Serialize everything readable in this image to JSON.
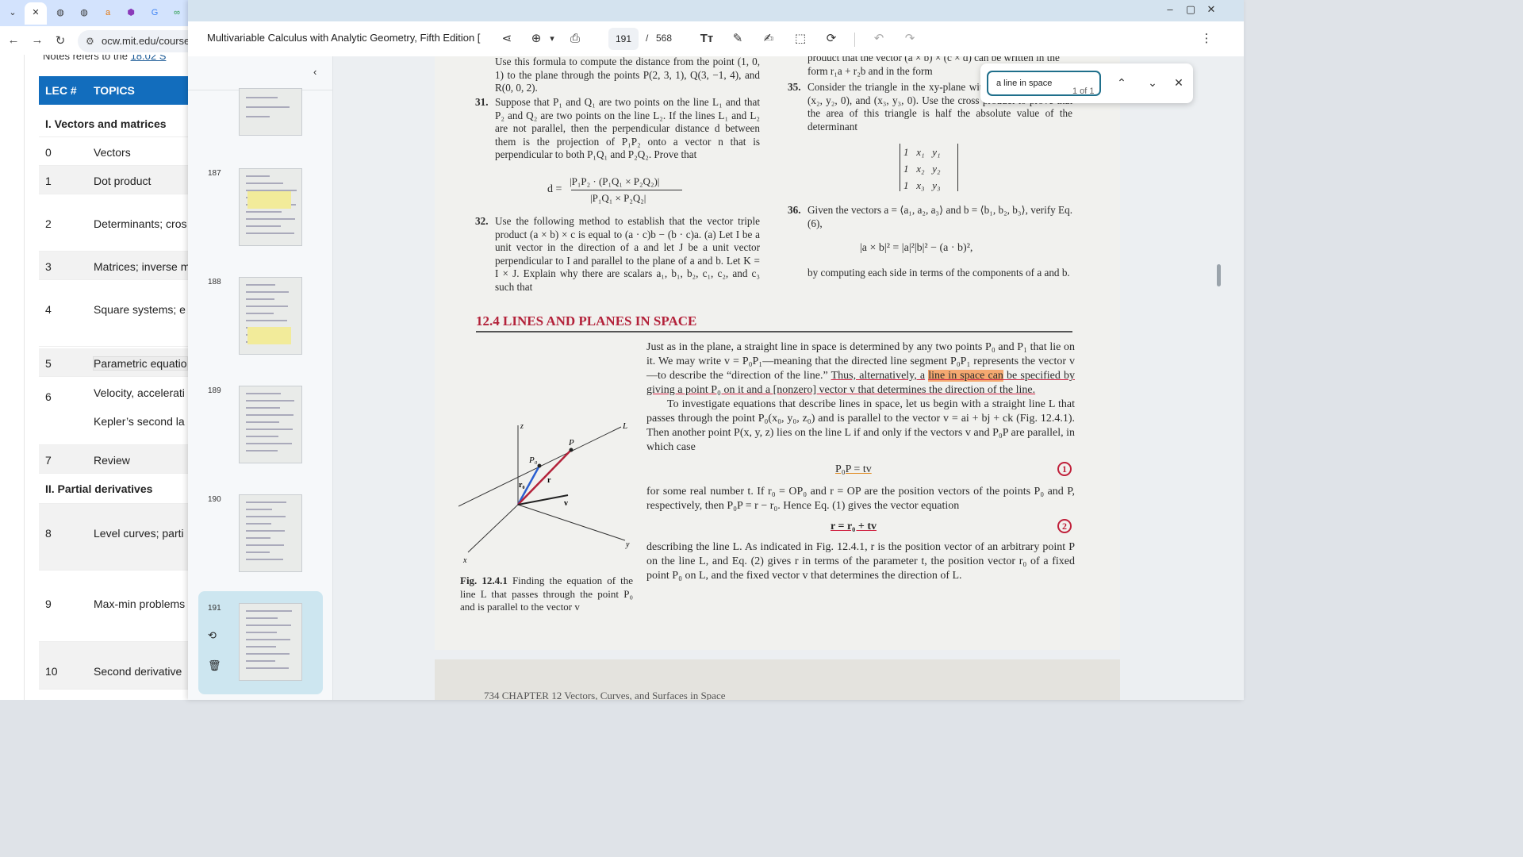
{
  "browser": {
    "url": "ocw.mit.edu/courses..."
  },
  "ocw": {
    "notes_prefix": "Notes refers to the",
    "notes_link": "18.02 S",
    "header": {
      "num": "LEC #",
      "topics": "TOPICS"
    },
    "rows": [
      {
        "num": "",
        "topic": "I. Vectors and matrices",
        "section": true
      },
      {
        "num": "0",
        "topic": "Vectors"
      },
      {
        "num": "1",
        "topic": "Dot product"
      },
      {
        "num": "2",
        "topic": "Determinants; cros"
      },
      {
        "num": "3",
        "topic": "Matrices; inverse m"
      },
      {
        "num": "4",
        "topic": "Square systems; e"
      },
      {
        "num": "5",
        "topic": "Parametric equatio"
      },
      {
        "num": "6",
        "topic": "Velocity, accelerati",
        "topic2": "Kepler’s second la"
      },
      {
        "num": "7",
        "topic": "Review"
      },
      {
        "num": "",
        "topic": "II. Partial derivatives",
        "section": true
      },
      {
        "num": "8",
        "topic": "Level curves; parti"
      },
      {
        "num": "9",
        "topic": "Max-min problems"
      },
      {
        "num": "10",
        "topic": "Second derivative"
      }
    ]
  },
  "viewer": {
    "title": "Multivariable Calculus with Analytic Geometry, Fifth Edition [",
    "current_page": "191",
    "page_sep": "/",
    "total_pages": "568",
    "thumbnails": [
      "187",
      "188",
      "189",
      "190",
      "191"
    ]
  },
  "find": {
    "query": "a line in space",
    "count": "1 of 1"
  },
  "pdf": {
    "ex_top_left": "Use this formula to compute the distance from the point (1, 0, 1) to the plane through the points P(2, 3, 1), Q(3, −1, 4), and R(0, 0, 2).",
    "ex31_num": "31.",
    "ex31": "Suppose that P₁ and Q₁ are two points on the line L₁ and that P₂ and Q₂ are two points on the line L₂. If the lines L₁ and L₂ are not parallel, then the perpendicular distance d between them is the projection of P₁P₂ onto a vector n that is perpendicular to both P₁Q₁ and P₂Q₂. Prove that",
    "ex31_formula_lhs": "d =",
    "ex31_formula_num": "|P₁P₂ · (P₁Q₁ × P₂Q₂)|",
    "ex31_formula_den": "|P₁Q₁ × P₂Q₂|",
    "ex32_num": "32.",
    "ex32": "Use the following method to establish that the vector triple product (a × b) × c is equal to (a · c)b − (b · c)a. (a) Let I be a unit vector in the direction of a and let J be a unit vector perpendicular to I and parallel to the plane of a and b. Let K = I × J. Explain why there are scalars a₁, b₁, b₂, c₁, c₂, and c₃ such that",
    "ex_top_right": "product that the vector (a × b) × (c × d) can be written in the form r₁a + r₂b and in the form",
    "ex35_num": "35.",
    "ex35": "Consider the triangle in the xy-plane with vertices (x₁, y₁, 0), (x₂, y₂, 0), and (x₃, y₃, 0). Use the cross product to prove that the area of this triangle is half the absolute value of the determinant",
    "det_rows": [
      "1   x₁   y₁",
      "1   x₂   y₂",
      "1   x₃   y₃"
    ],
    "ex36_num": "36.",
    "ex36": "Given the vectors a = ⟨a₁, a₂, a₃⟩ and b = ⟨b₁, b₂, b₃⟩, verify Eq. (6),",
    "ex36_formula": "|a × b|² = |a|²|b|² − (a · b)²,",
    "ex36_end": "by computing each side in terms of the components of a and b.",
    "section_title": "12.4   LINES AND PLANES IN SPACE",
    "para1_a": "Just as in the plane, a straight line in space is determined by any two points P₀ and P₁ that lie on it. We may write v = P₀P₁—meaning that the directed line segment P₀P₁ represents the vector v—to describe the “direction of the line.” ",
    "para1_b": "Thus, alternatively, a",
    "para1_hl": "line in space can",
    "para1_c": " be specified by giving a point P₀ on it and a [nonzero] vector v that determines the direction of the line.",
    "para2": "To investigate equations that describe lines in space, let us begin with a straight line L that passes through the point P₀(x₀, y₀, z₀) and is parallel to the vector v = ai + bj + ck (Fig. 12.4.1). Then another point P(x, y, z) lies on the line L if and only if the vectors v and P₀P are parallel, in which case",
    "eq1": "P₀P = tv",
    "eq1_num": "1",
    "para3": "for some real number t. If r₀ = OP₀ and r = OP are the position vectors of the points P₀ and P, respectively, then P₀P = r − r₀. Hence Eq. (1) gives the vector equation",
    "eq2": "r = r₀ + tv",
    "eq2_num": "2",
    "para4": "describing the line L. As indicated in Fig. 12.4.1, r is the position vector of an arbitrary point P on the line L, and Eq. (2) gives r in terms of the parameter t, the position vector r₀ of a fixed point P₀ on L, and the fixed vector v that determines the direction of L.",
    "fig_caption_bold": "Fig. 12.4.1",
    "fig_caption": "  Finding the equation of the line L that passes through the point P₀ and is parallel to the vector v",
    "fig_labels": {
      "z": "z",
      "L": "L",
      "P": "P",
      "P0": "P₀",
      "r0": "r₀",
      "r": "r",
      "v": "v",
      "x": "x",
      "y": "y"
    },
    "next_page_head": "734     CHAPTER 12     Vectors, Curves, and Surfaces in Space"
  },
  "colors": {
    "accent": "#126dbd",
    "section_red": "#b3223a",
    "find_border": "#1f6f8b",
    "search_hl": "#f4a870"
  }
}
